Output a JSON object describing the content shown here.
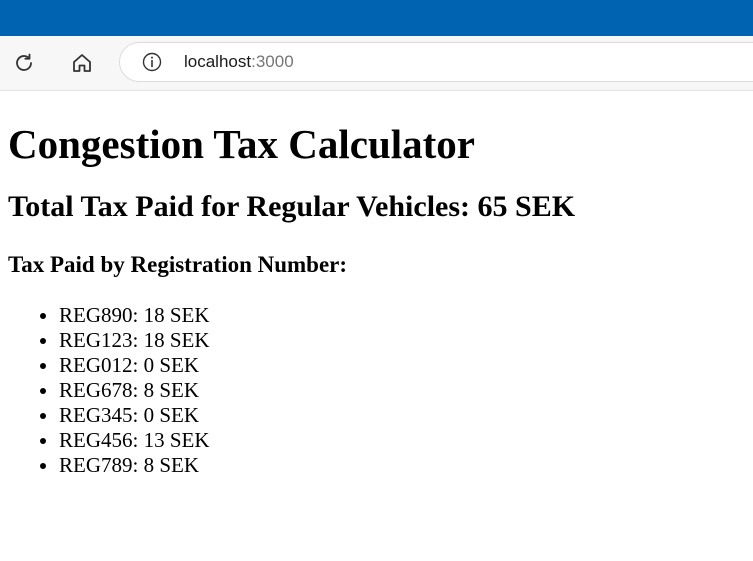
{
  "browser": {
    "url_host": "localhost",
    "url_port": ":3000",
    "titlebar_color": "#0063b1",
    "icons": [
      "reload-icon",
      "home-icon",
      "info-icon"
    ]
  },
  "page": {
    "title": "Congestion Tax Calculator",
    "total_label": "Total Tax Paid for Regular Vehicles: 65 SEK",
    "by_reg_heading": "Tax Paid by Registration Number:",
    "items": [
      "REG890: 18 SEK",
      "REG123: 18 SEK",
      "REG012: 0 SEK",
      "REG678: 8 SEK",
      "REG345: 0 SEK",
      "REG456: 13 SEK",
      "REG789: 8 SEK"
    ]
  }
}
